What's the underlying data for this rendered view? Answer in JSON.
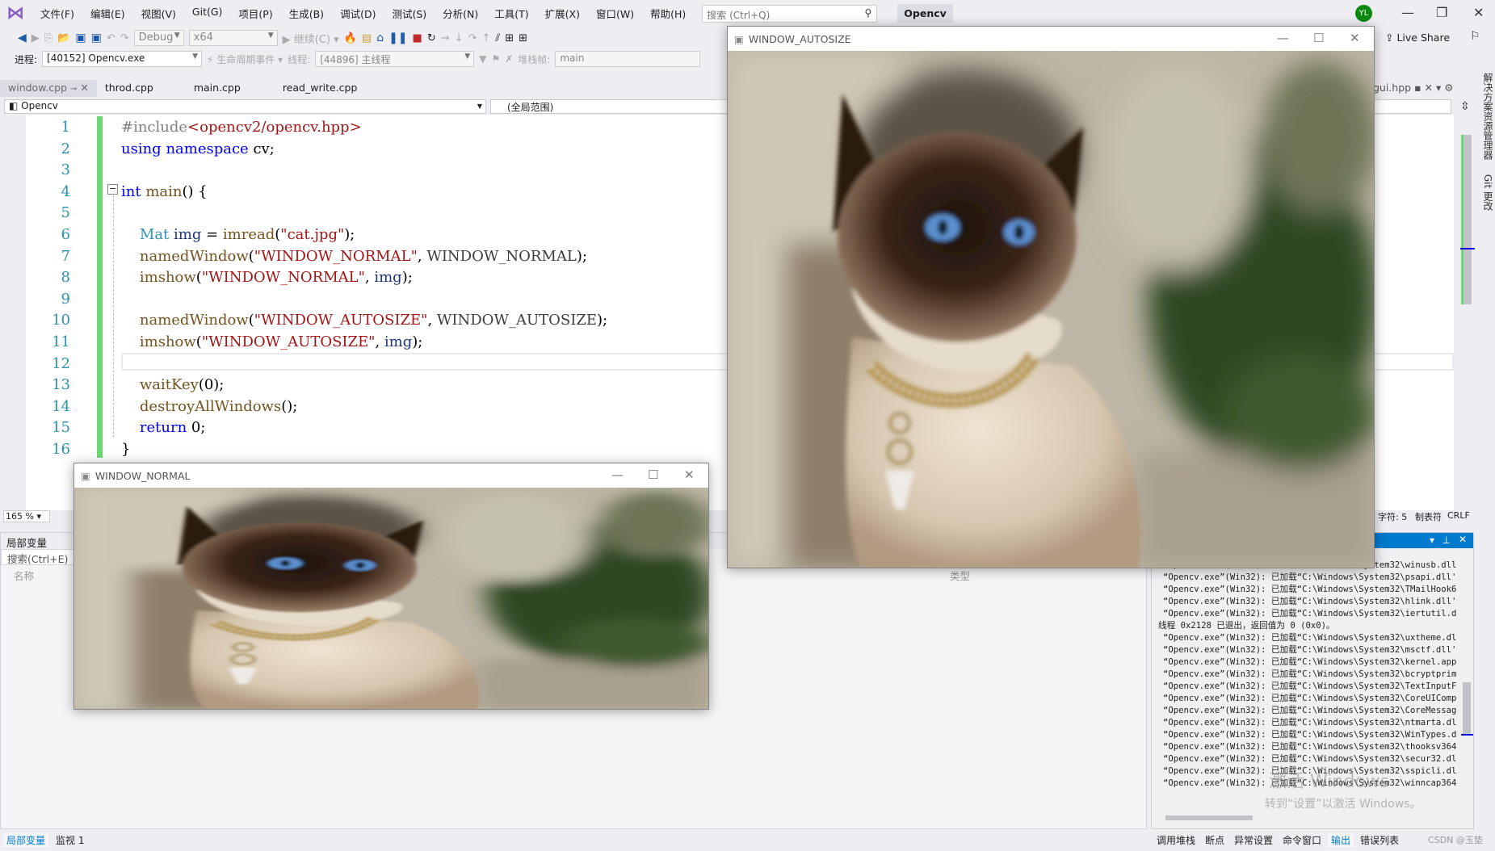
{
  "menubar": {
    "items": [
      "文件(F)",
      "编辑(E)",
      "视图(V)",
      "Git(G)",
      "项目(P)",
      "生成(B)",
      "调试(D)",
      "测试(S)",
      "分析(N)",
      "工具(T)",
      "扩展(X)",
      "窗口(W)",
      "帮助(H)"
    ],
    "search_placeholder": "搜索 (Ctrl+Q)",
    "solution_name": "Opencv",
    "avatar_initials": "YL",
    "live_share": "Live Share"
  },
  "toolbar": {
    "config": "Debug",
    "platform": "x64",
    "continue_label": "继续(C)",
    "process_label": "进程:",
    "process_value": "[40152] Opencv.exe",
    "lifecycle_label": "生命周期事件",
    "thread_label": "线程:",
    "thread_value": "[44896] 主线程",
    "stackframe_label": "堆栈帧:",
    "stackframe_value": "main"
  },
  "tabs": [
    {
      "label": "window.cpp",
      "active": true
    },
    {
      "label": "throd.cpp"
    },
    {
      "label": "main.cpp"
    },
    {
      "label": "read_write.cpp"
    }
  ],
  "right_tab": "gui.hpp",
  "nav": {
    "project": "Opencv",
    "scope": "(全局范围)"
  },
  "code": [
    [
      [
        "#include",
        "pp"
      ],
      [
        "<opencv2/opencv.hpp>",
        "str"
      ]
    ],
    [
      [
        "using",
        "kw"
      ],
      [
        " ",
        "pl"
      ],
      [
        "namespace",
        "kw"
      ],
      [
        " cv;",
        "pl"
      ]
    ],
    [],
    [
      [
        "int",
        "kw"
      ],
      [
        " ",
        "pl"
      ],
      [
        "main",
        "fn"
      ],
      [
        "() {",
        "pl"
      ]
    ],
    [],
    [
      [
        "    ",
        "pl"
      ],
      [
        "Mat",
        "type"
      ],
      [
        " ",
        "pl"
      ],
      [
        "img",
        "var"
      ],
      [
        " = ",
        "pl"
      ],
      [
        "imread",
        "fn"
      ],
      [
        "(",
        "pl"
      ],
      [
        "\"cat.jpg\"",
        "str"
      ],
      [
        ");",
        "pl"
      ]
    ],
    [
      [
        "    ",
        "pl"
      ],
      [
        "namedWindow",
        "fn"
      ],
      [
        "(",
        "pl"
      ],
      [
        "\"WINDOW_NORMAL\"",
        "str"
      ],
      [
        ", ",
        "pl"
      ],
      [
        "WINDOW_NORMAL",
        "mac"
      ],
      [
        ");",
        "pl"
      ]
    ],
    [
      [
        "    ",
        "pl"
      ],
      [
        "imshow",
        "fn"
      ],
      [
        "(",
        "pl"
      ],
      [
        "\"WINDOW_NORMAL\"",
        "str"
      ],
      [
        ", ",
        "pl"
      ],
      [
        "img",
        "var"
      ],
      [
        ");",
        "pl"
      ]
    ],
    [],
    [
      [
        "    ",
        "pl"
      ],
      [
        "namedWindow",
        "fn"
      ],
      [
        "(",
        "pl"
      ],
      [
        "\"WINDOW_AUTOSIZE\"",
        "str"
      ],
      [
        ", ",
        "pl"
      ],
      [
        "WINDOW_AUTOSIZE",
        "mac"
      ],
      [
        ");",
        "pl"
      ]
    ],
    [
      [
        "    ",
        "pl"
      ],
      [
        "imshow",
        "fn"
      ],
      [
        "(",
        "pl"
      ],
      [
        "\"WINDOW_AUTOSIZE\"",
        "str"
      ],
      [
        ", ",
        "pl"
      ],
      [
        "img",
        "var"
      ],
      [
        ");",
        "pl"
      ]
    ],
    [],
    [
      [
        "    ",
        "pl"
      ],
      [
        "waitKey",
        "fn"
      ],
      [
        "(0);",
        "pl"
      ]
    ],
    [
      [
        "    ",
        "pl"
      ],
      [
        "destroyAllWindows",
        "fn"
      ],
      [
        "();",
        "pl"
      ]
    ],
    [
      [
        "    ",
        "pl"
      ],
      [
        "return",
        "kw"
      ],
      [
        " 0;",
        "pl"
      ]
    ],
    [
      [
        "}",
        "pl"
      ]
    ]
  ],
  "status": {
    "zoom": "165 %",
    "col": "字符: 5",
    "tabs": "制表符",
    "eol": "CRLF"
  },
  "locals": {
    "title": "局部变量",
    "search": "搜索(Ctrl+E)",
    "col_name": "名称",
    "col_type": "类型"
  },
  "output_lines": [
    "“Opencv.exe”(Win32): 已加载“C:\\Windows\\System32\\winusb.dll",
    "“Opencv.exe”(Win32): 已加载“C:\\Windows\\System32\\psapi.dll'",
    "“Opencv.exe”(Win32): 已加载“C:\\Windows\\System32\\TMailHook6",
    "“Opencv.exe”(Win32): 已加载“C:\\Windows\\System32\\hlink.dll'",
    "“Opencv.exe”(Win32): 已加载“C:\\Windows\\System32\\iertutil.d",
    "线程 0x2128 已退出，返回值为 0 (0x0)。",
    "“Opencv.exe”(Win32): 已加载“C:\\Windows\\System32\\uxtheme.dl",
    "“Opencv.exe”(Win32): 已加载“C:\\Windows\\System32\\msctf.dll'",
    "“Opencv.exe”(Win32): 已加载“C:\\Windows\\System32\\kernel.app",
    "“Opencv.exe”(Win32): 已加载“C:\\Windows\\System32\\bcryptprim",
    "“Opencv.exe”(Win32): 已加载“C:\\Windows\\System32\\TextInputF",
    "“Opencv.exe”(Win32): 已加载“C:\\Windows\\System32\\CoreUIComp",
    "“Opencv.exe”(Win32): 已加载“C:\\Windows\\System32\\CoreMessag",
    "“Opencv.exe”(Win32): 已加载“C:\\Windows\\System32\\ntmarta.dl",
    "“Opencv.exe”(Win32): 已加载“C:\\Windows\\System32\\WinTypes.d",
    "“Opencv.exe”(Win32): 已加载“C:\\Windows\\System32\\thooksv364",
    "“Opencv.exe”(Win32): 已加载“C:\\Windows\\System32\\secur32.dl",
    "“Opencv.exe”(Win32): 已加载“C:\\Windows\\System32\\sspicli.dl",
    "“Opencv.exe”(Win32): 已加载“C:\\Windows\\System32\\winncap364"
  ],
  "watermark": {
    "line1": "激活 Windows",
    "line2": "转到“设置”以激活 Windows。"
  },
  "bottom_left_tabs": [
    "局部变量",
    "监视 1"
  ],
  "bottom_right_tabs": [
    "调用堆栈",
    "断点",
    "异常设置",
    "命令窗口",
    "输出",
    "错误列表"
  ],
  "credit": "CSDN @玉垫",
  "side_tabs": [
    "解决方案资源管理器",
    "Git 更改"
  ],
  "windows": {
    "autosize_title": "WINDOW_AUTOSIZE",
    "normal_title": "WINDOW_NORMAL"
  },
  "colors": {
    "accent": "#007acc",
    "vs_purple": "#865fc5",
    "green_margin": "#6ed66e",
    "avatar": "#098a0f"
  }
}
